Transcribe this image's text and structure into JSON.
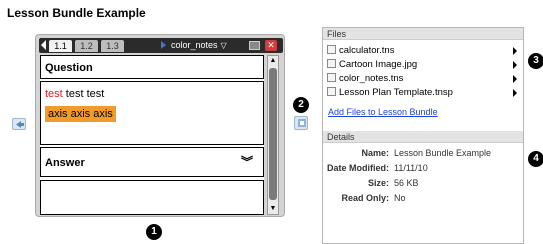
{
  "page_title": "Lesson Bundle Example",
  "device": {
    "tabs": [
      "1.1",
      "1.2",
      "1.3"
    ],
    "document_name": "color_notes",
    "question_label": "Question",
    "body_text": {
      "red_word": "test",
      "rest": " test test"
    },
    "highlight_text": "axis axis axis",
    "answer_label": "Answer"
  },
  "callouts": {
    "c1": "1",
    "c2": "2",
    "c3": "3",
    "c4": "4"
  },
  "files": {
    "header": "Files",
    "items": [
      {
        "name": "calculator.tns",
        "icon": "tns-file-icon"
      },
      {
        "name": "Cartoon Image.jpg",
        "icon": "image-file-icon"
      },
      {
        "name": "color_notes.tns",
        "icon": "tns-file-icon"
      },
      {
        "name": "Lesson Plan Template.tnsp",
        "icon": "template-file-icon"
      }
    ],
    "add_link": "Add Files to Lesson Bundle"
  },
  "details": {
    "header": "Details",
    "rows": [
      {
        "key": "Name:",
        "value": "Lesson Bundle Example"
      },
      {
        "key": "Date Modified:",
        "value": "11/11/10"
      },
      {
        "key": "Size:",
        "value": "56 KB"
      },
      {
        "key": "Read Only:",
        "value": "No"
      }
    ]
  },
  "colors": {
    "highlight": "#f39b28",
    "red_text": "#e02020",
    "link": "#2043d8",
    "tab_bar": "#2b2b2b"
  }
}
